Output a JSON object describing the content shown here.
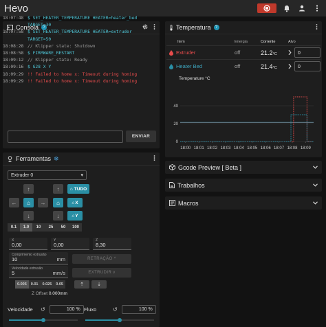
{
  "app": {
    "title": "Hevo"
  },
  "colors": {
    "accent": "#2a8fa5",
    "error": "#e74c4c",
    "command": "#4fc3d4",
    "estop": "#c0392b",
    "extruder": "#e74c4c",
    "bed": "#2a8fa5"
  },
  "icons": {
    "estop": "emergency-stop-icon",
    "bell": "bell-icon",
    "user": "account-icon",
    "menu": "more-vert-icon",
    "console": "console-icon",
    "thermometer": "thermometer-icon",
    "tools": "gamepad-icon",
    "snowflake": "snowflake-icon"
  },
  "console": {
    "title": "Consola",
    "lines": [
      {
        "time": "18:07:48",
        "msg": "$ SET_HEATER_TEMPERATURE HEATER=heater_bed",
        "kind": "cmd"
      },
      {
        "time": "",
        "msg": "TARGET=30",
        "kind": "cmd"
      },
      {
        "time": "18:07:58",
        "msg": "$ SET_HEATER_TEMPERATURE HEATER=extruder",
        "kind": "cmd"
      },
      {
        "time": "",
        "msg": "TARGET=50",
        "kind": "cmd"
      },
      {
        "time": "18:08:28",
        "msg": "// Klipper state: Shutdown",
        "kind": "info"
      },
      {
        "time": "18:08:58",
        "msg": "$ FIRMWARE_RESTART",
        "kind": "cmd"
      },
      {
        "time": "18:09:12",
        "msg": "// Klipper state: Ready",
        "kind": "info"
      },
      {
        "time": "18:09:16",
        "msg": "$ G28 X Y",
        "kind": "cmd"
      },
      {
        "time": "18:09:29",
        "msg": "!! Failed to home x: Timeout during homing",
        "kind": "err"
      },
      {
        "time": "18:09:29",
        "msg": "!! Failed to home x: Timeout during homing",
        "kind": "err"
      }
    ],
    "send_label": "ENVIAR"
  },
  "temperature": {
    "title": "Temperatura",
    "headers": {
      "item": "Item",
      "power": "Energia",
      "current": "Corrente",
      "target": "Alvo"
    },
    "rows": [
      {
        "name": "Extruder",
        "power": "off",
        "current": "21.2",
        "unit": "°C",
        "target": "0"
      },
      {
        "name": "Heater Bed",
        "power": "off",
        "current": "21.4",
        "unit": "°C",
        "target": "0"
      }
    ]
  },
  "chart_data": {
    "type": "line",
    "title": "",
    "ylabel": "Temperature °C",
    "xlabel": "",
    "ylim": [
      0,
      60
    ],
    "y_ticks": [
      0,
      20,
      40
    ],
    "x_ticks": [
      "18:00",
      "18:01",
      "18:02",
      "18:03",
      "18:04",
      "18:05",
      "18:06",
      "18:07",
      "18:08",
      "18:09"
    ],
    "x_minutes": [
      0,
      1,
      2,
      3,
      4,
      5,
      6,
      7,
      8,
      9
    ],
    "xlim": [
      -0.4,
      9.6
    ],
    "series": [
      {
        "color": "#e74c4c",
        "style": "solid",
        "x": [
          -0.4,
          9.6
        ],
        "y": [
          21.2,
          21.2
        ]
      },
      {
        "color": "#2a8fa5",
        "style": "solid",
        "x": [
          -0.4,
          9.6
        ],
        "y": [
          21.4,
          21.4
        ]
      },
      {
        "color": "#e74c4c",
        "style": "dashed",
        "x": [
          -0.4,
          8.1,
          8.1,
          9.1,
          9.1,
          9.6
        ],
        "y": [
          0,
          0,
          50,
          50,
          0,
          0
        ]
      },
      {
        "color": "#2a8fa5",
        "style": "dashed",
        "x": [
          -0.4,
          7.9,
          7.9,
          9.1,
          9.1,
          9.6
        ],
        "y": [
          0,
          0,
          30,
          30,
          0,
          0
        ]
      }
    ]
  },
  "panels": {
    "gcode_preview": "Gcode Preview [ Beta ]",
    "jobs": "Trabalhos",
    "macros": "Macros"
  },
  "tools": {
    "title": "Ferramentas",
    "extruder_select": "Extruder 0",
    "home_all": "TUDO",
    "home_x": "X",
    "home_y": "Y",
    "steps": [
      "0.1",
      "1.0",
      "10",
      "25",
      "50",
      "100"
    ],
    "active_step": "1.0",
    "x_label": "X",
    "x_value": "0,00",
    "y_label": "Y",
    "y_value": "0,00",
    "z_label": "Z",
    "z_value": "8,30",
    "length_label": "Comprimento extrusão",
    "length_value": "10",
    "length_unit": "mm",
    "speed_label": "Velocidade extrusão",
    "speed_value": "5",
    "speed_unit": "mm/s",
    "retract_label": "RETRAÇÃO",
    "extrude_label": "EXTRUDIR",
    "z_steps": [
      "0.005",
      "0.01",
      "0.025",
      "0.05"
    ],
    "active_z_step": "0.005",
    "z_offset_label": "Z Offset",
    "z_offset_value": "0.000mm",
    "speed_factor_label": "Velocidade",
    "speed_factor_value": "100 %",
    "speed_factor_level": 1.0,
    "flow_label": "Fluxo",
    "flow_value": "100 %",
    "flow_level": 1.0
  }
}
